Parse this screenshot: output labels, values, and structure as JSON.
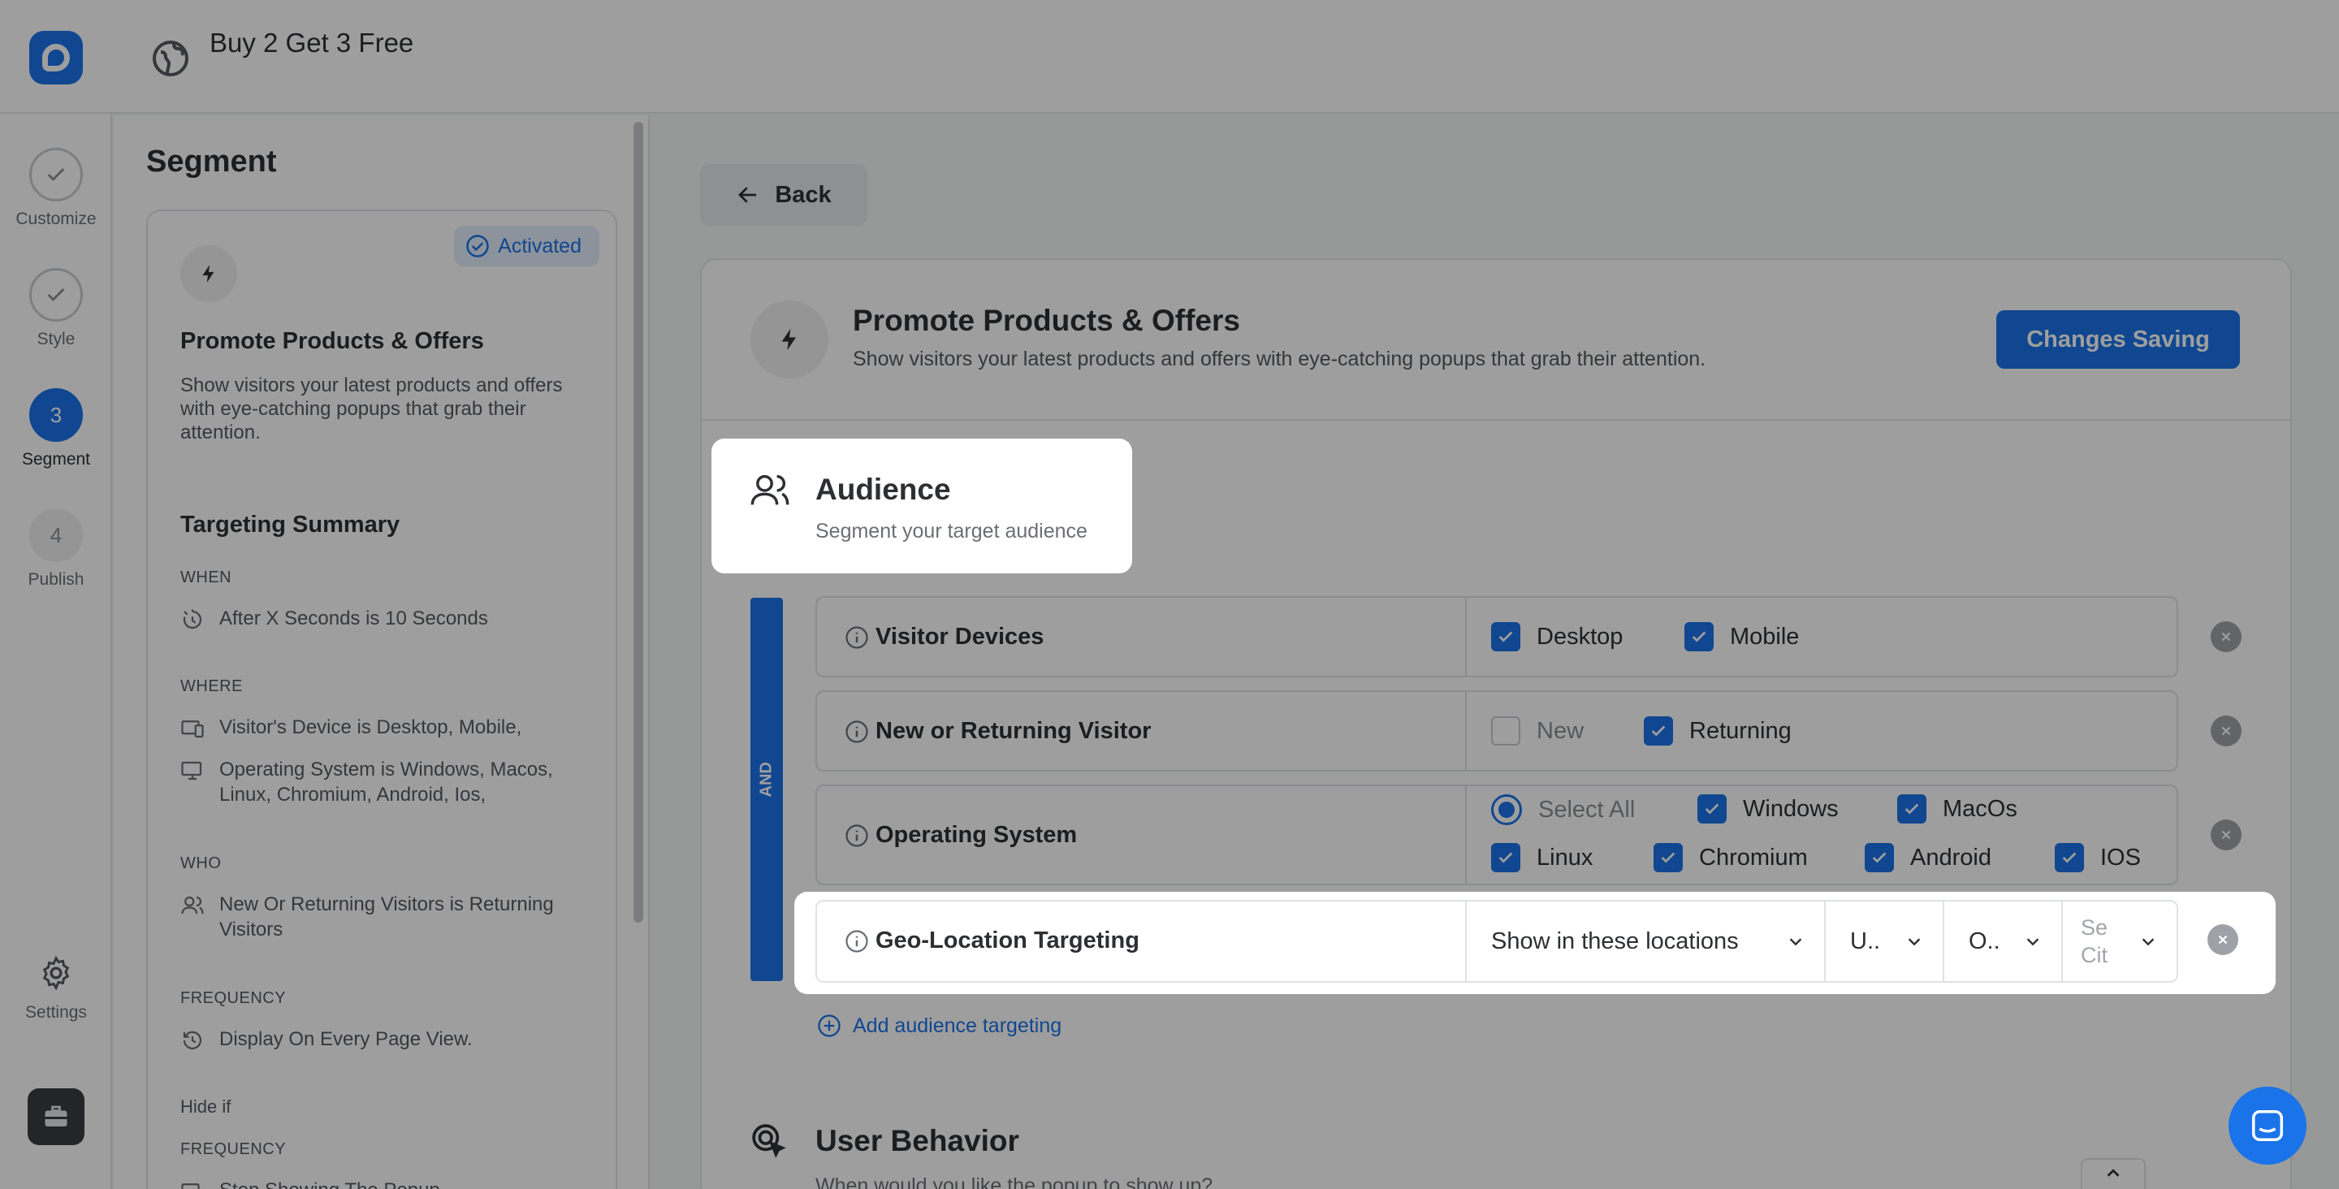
{
  "header": {
    "title": "Buy 2 Get 3 Free"
  },
  "steps": [
    {
      "label": "Customize",
      "state": "done",
      "number": ""
    },
    {
      "label": "Style",
      "state": "done",
      "number": ""
    },
    {
      "label": "Segment",
      "state": "active",
      "number": "3"
    },
    {
      "label": "Publish",
      "state": "future",
      "number": "4"
    }
  ],
  "settings_label": "Settings",
  "sidebar": {
    "title": "Segment",
    "card": {
      "badge": "Activated",
      "title": "Promote Products & Offers",
      "description": "Show visitors your latest products and offers with eye-catching popups that grab their attention."
    },
    "summary_title": "Targeting Summary",
    "when_label": "WHEN",
    "when_item": "After X Seconds is 10 Seconds",
    "where_label": "WHERE",
    "where_items": [
      "Visitor's Device is Desktop, Mobile,",
      "Operating System is Windows, Macos, Linux, Chromium, Android, Ios,"
    ],
    "who_label": "WHO",
    "who_item": "New Or Returning Visitors is Returning Visitors",
    "frequency_label": "FREQUENCY",
    "frequency_item": "Display On Every Page View.",
    "hide_if_label": "Hide if",
    "frequency_label_2": "FREQUENCY",
    "frequency_item_2": "Stop Showing The Popup"
  },
  "main": {
    "back_label": "Back",
    "title": "Promote Products & Offers",
    "description": "Show visitors your latest products and offers with eye-catching popups that grab their attention.",
    "save_label": "Changes Saving",
    "audience": {
      "title": "Audience",
      "subtitle": "Segment your target audience"
    },
    "and_label": "AND",
    "rules": {
      "devices": {
        "label": "Visitor Devices",
        "desktop": "Desktop",
        "mobile": "Mobile"
      },
      "visitor": {
        "label": "New or Returning Visitor",
        "new": "New",
        "returning": "Returning"
      },
      "os": {
        "label": "Operating System",
        "select_all": "Select All",
        "windows": "Windows",
        "macos": "MacOs",
        "linux": "Linux",
        "chromium": "Chromium",
        "android": "Android",
        "ios": "IOS"
      },
      "geo": {
        "label": "Geo-Location Targeting",
        "mode": "Show in these locations",
        "country": "U..",
        "region": "O..",
        "city_placeholder_1": "Se",
        "city_placeholder_2": "Cit"
      }
    },
    "add_targeting": "Add audience targeting",
    "user_behavior": {
      "title": "User Behavior",
      "subtitle": "When would you like the popup to show up?"
    }
  }
}
